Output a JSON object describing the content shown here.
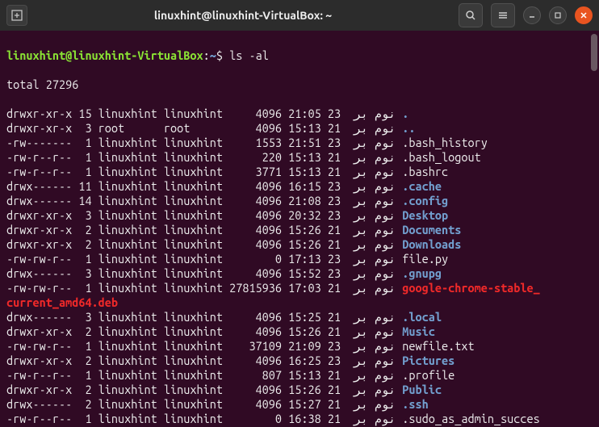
{
  "titlebar": {
    "title": "linuxhint@linuxhint-VirtualBox: ~"
  },
  "prompt": {
    "user_host": "linuxhint@linuxhint-VirtualBox",
    "colon": ":",
    "path": "~",
    "dollar": "$",
    "command": "ls -al"
  },
  "total_line": "total 27296",
  "month": "نوم بر",
  "wrapped_filename": "current_amd64.deb",
  "rows": [
    {
      "perms": "drwxr-xr-x",
      "links": "15",
      "owner": "linuxhint",
      "group": "linuxhint",
      "size": "4096",
      "time": "21:05",
      "day": "23",
      "name": ".",
      "cls": "dir-name"
    },
    {
      "perms": "drwxr-xr-x",
      "links": "3",
      "owner": "root",
      "group": "root",
      "size": "4096",
      "time": "15:13",
      "day": "21",
      "name": "..",
      "cls": "dir-name"
    },
    {
      "perms": "-rw-------",
      "links": "1",
      "owner": "linuxhint",
      "group": "linuxhint",
      "size": "1553",
      "time": "21:51",
      "day": "23",
      "name": ".bash_history",
      "cls": "file-name"
    },
    {
      "perms": "-rw-r--r--",
      "links": "1",
      "owner": "linuxhint",
      "group": "linuxhint",
      "size": "220",
      "time": "15:13",
      "day": "21",
      "name": ".bash_logout",
      "cls": "file-name"
    },
    {
      "perms": "-rw-r--r--",
      "links": "1",
      "owner": "linuxhint",
      "group": "linuxhint",
      "size": "3771",
      "time": "15:13",
      "day": "21",
      "name": ".bashrc",
      "cls": "file-name"
    },
    {
      "perms": "drwx------",
      "links": "11",
      "owner": "linuxhint",
      "group": "linuxhint",
      "size": "4096",
      "time": "16:15",
      "day": "23",
      "name": ".cache",
      "cls": "dir-name"
    },
    {
      "perms": "drwx------",
      "links": "14",
      "owner": "linuxhint",
      "group": "linuxhint",
      "size": "4096",
      "time": "21:08",
      "day": "23",
      "name": ".config",
      "cls": "dir-name"
    },
    {
      "perms": "drwxr-xr-x",
      "links": "3",
      "owner": "linuxhint",
      "group": "linuxhint",
      "size": "4096",
      "time": "20:32",
      "day": "23",
      "name": "Desktop",
      "cls": "dir-name"
    },
    {
      "perms": "drwxr-xr-x",
      "links": "2",
      "owner": "linuxhint",
      "group": "linuxhint",
      "size": "4096",
      "time": "15:26",
      "day": "21",
      "name": "Documents",
      "cls": "dir-name"
    },
    {
      "perms": "drwxr-xr-x",
      "links": "2",
      "owner": "linuxhint",
      "group": "linuxhint",
      "size": "4096",
      "time": "15:26",
      "day": "21",
      "name": "Downloads",
      "cls": "dir-name"
    },
    {
      "perms": "-rw-rw-r--",
      "links": "1",
      "owner": "linuxhint",
      "group": "linuxhint",
      "size": "0",
      "time": "17:13",
      "day": "23",
      "name": "file.py",
      "cls": "file-name"
    },
    {
      "perms": "drwx------",
      "links": "3",
      "owner": "linuxhint",
      "group": "linuxhint",
      "size": "4096",
      "time": "15:52",
      "day": "23",
      "name": ".gnupg",
      "cls": "dir-name"
    },
    {
      "perms": "-rw-rw-r--",
      "links": "1",
      "owner": "linuxhint",
      "group": "linuxhint",
      "size": "27815936",
      "time": "17:03",
      "day": "21",
      "name": "google-chrome-stable_",
      "cls": "red-name"
    },
    {
      "perms": "drwx------",
      "links": "3",
      "owner": "linuxhint",
      "group": "linuxhint",
      "size": "4096",
      "time": "15:25",
      "day": "21",
      "name": ".local",
      "cls": "dir-name"
    },
    {
      "perms": "drwxr-xr-x",
      "links": "2",
      "owner": "linuxhint",
      "group": "linuxhint",
      "size": "4096",
      "time": "15:26",
      "day": "21",
      "name": "Music",
      "cls": "dir-name"
    },
    {
      "perms": "-rw-rw-r--",
      "links": "1",
      "owner": "linuxhint",
      "group": "linuxhint",
      "size": "37109",
      "time": "21:09",
      "day": "23",
      "name": "newfile.txt",
      "cls": "file-name"
    },
    {
      "perms": "drwxr-xr-x",
      "links": "2",
      "owner": "linuxhint",
      "group": "linuxhint",
      "size": "4096",
      "time": "16:25",
      "day": "23",
      "name": "Pictures",
      "cls": "dir-name"
    },
    {
      "perms": "-rw-r--r--",
      "links": "1",
      "owner": "linuxhint",
      "group": "linuxhint",
      "size": "807",
      "time": "15:13",
      "day": "21",
      "name": ".profile",
      "cls": "file-name"
    },
    {
      "perms": "drwxr-xr-x",
      "links": "2",
      "owner": "linuxhint",
      "group": "linuxhint",
      "size": "4096",
      "time": "15:26",
      "day": "21",
      "name": "Public",
      "cls": "dir-name"
    },
    {
      "perms": "drwx------",
      "links": "2",
      "owner": "linuxhint",
      "group": "linuxhint",
      "size": "4096",
      "time": "15:27",
      "day": "21",
      "name": ".ssh",
      "cls": "dir-name"
    },
    {
      "perms": "-rw-r--r--",
      "links": "1",
      "owner": "linuxhint",
      "group": "linuxhint",
      "size": "0",
      "time": "16:38",
      "day": "21",
      "name": ".sudo_as_admin_succes",
      "cls": "file-name"
    }
  ]
}
